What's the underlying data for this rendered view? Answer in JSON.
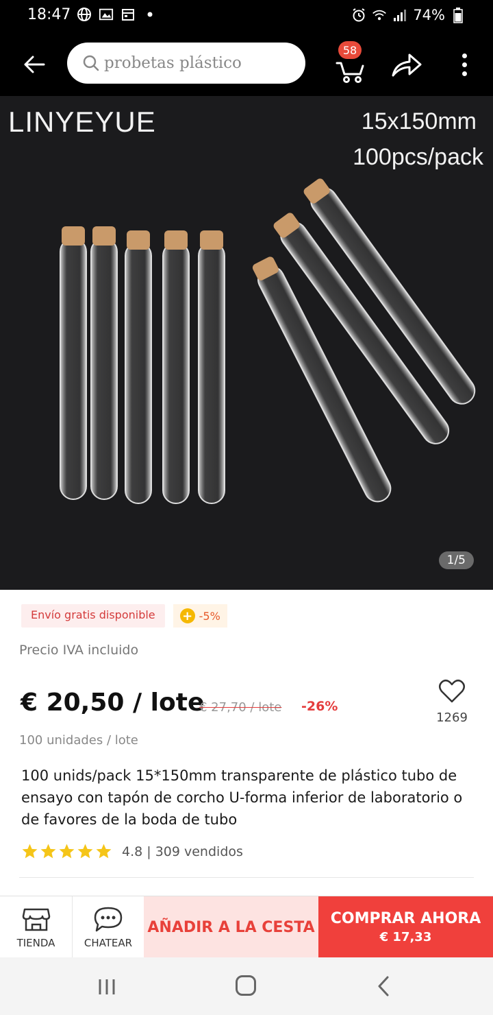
{
  "status_bar": {
    "time": "18:47",
    "battery": "74%"
  },
  "search": {
    "placeholder": "probetas plástico"
  },
  "cart": {
    "badge_count": "58"
  },
  "image": {
    "brand_text": "LINYEYUE",
    "spec_size": "15x150mm",
    "spec_pack": "100pcs/pack",
    "page_indicator": "1/5"
  },
  "tags": {
    "shipping": "Envío gratis disponible",
    "coupon": "-5%"
  },
  "vat_note": "Precio IVA incluido",
  "price": {
    "current": "€ 20,50 / lote",
    "original": "€ 27,70 / lote",
    "discount": "-26%"
  },
  "wishlist": {
    "count": "1269"
  },
  "units_note": "100 unidades / lote",
  "product": {
    "title": "100 unids/pack 15*150mm transparente de plástico tubo de ensayo con tapón de corcho U-forma inferior de laboratorio o de favores de la boda de tubo"
  },
  "rating": {
    "stars": 5,
    "text": "4.8 | 309 vendidos"
  },
  "actions": {
    "store_label": "TIENDA",
    "chat_label": "CHATEAR",
    "add_to_cart_label": "AÑADIR A LA CESTA",
    "buy_now_label": "COMPRAR AHORA",
    "buy_now_price": "€ 17,33"
  },
  "colors": {
    "accent_red": "#f0403c",
    "header_bg": "#000000",
    "star_yellow": "#f5c518",
    "cork": "#c99a6a"
  }
}
